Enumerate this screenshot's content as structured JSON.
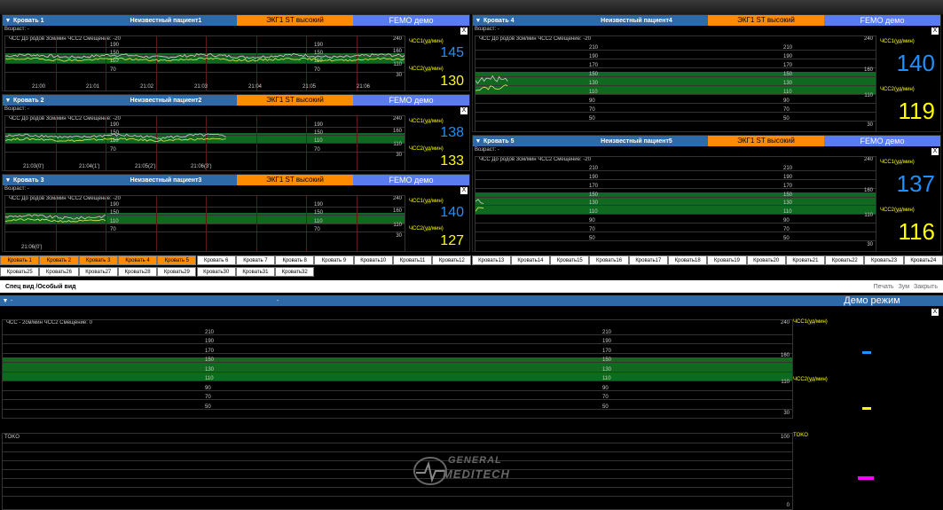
{
  "panels": [
    {
      "bed": "Кровать 1",
      "patient": "Неизвестный пациент1",
      "alarm": "ЭКГ1 ST высокий",
      "mode": "FEMO демо",
      "age": "Возраст: -",
      "close": "X",
      "sub_hdr": "ЧСС     До родов  3см/мин  ЧСС2  Смещение: -20",
      "scale_top": "240",
      "scale_mid": "160",
      "scale_low": "110",
      "scale_bot": "30",
      "grid_left": [
        "190",
        "150",
        "110",
        "70"
      ],
      "grid_right": [
        "190",
        "150",
        "110",
        "70"
      ],
      "times": [
        "21:00",
        "21:01",
        "21:02",
        "21:03",
        "21:04",
        "21:05",
        "21:06"
      ],
      "hr1_label": "ЧСС1(уд/мин)",
      "hr1": "145",
      "hr2_label": "ЧСС2(уд/мин)",
      "hr2": "130"
    },
    {
      "bed": "Кровать 2",
      "patient": "Неизвестный пациент2",
      "alarm": "ЭКГ1 ST высокий",
      "mode": "FEMO демо",
      "age": "Возраст: -",
      "close": "X",
      "sub_hdr": "ЧСС     До родов  3см/мин  ЧСС2  Смещение: -20",
      "scale_top": "240",
      "scale_mid": "160",
      "scale_low": "110",
      "scale_bot": "30",
      "grid_left": [
        "190",
        "150",
        "110",
        "70"
      ],
      "grid_right": [
        "190",
        "150",
        "110",
        "70"
      ],
      "times": [
        "21:03(0')",
        "21:04(1')",
        "21:05(2')",
        "21:06(3')"
      ],
      "hr1_label": "ЧСС1(уд/мин)",
      "hr1": "138",
      "hr2_label": "ЧСС2(уд/мин)",
      "hr2": "133"
    },
    {
      "bed": "Кровать 3",
      "patient": "Неизвестный пациент3",
      "alarm": "ЭКГ1 ST высокий",
      "mode": "FEMO демо",
      "age": "Возраст: -",
      "close": "X",
      "sub_hdr": "ЧСС     До родов  3см/мин  ЧСС2  Смещение: -20",
      "scale_top": "240",
      "scale_mid": "160",
      "scale_low": "110",
      "scale_bot": "30",
      "grid_left": [
        "190",
        "150",
        "110",
        "70"
      ],
      "grid_right": [
        "190",
        "150",
        "110",
        "70"
      ],
      "times": [
        "21:06(0')"
      ],
      "hr1_label": "ЧСС1(уд/мин)",
      "hr1": "140",
      "hr2_label": "ЧСС2(уд/мин)",
      "hr2": "127"
    },
    {
      "bed": "Кровать 4",
      "patient": "Неизвестный пациент4",
      "alarm": "ЭКГ1 ST высокий",
      "mode": "FEMO демо",
      "age": "Возраст: -",
      "close": "X",
      "sub_hdr": "ЧСС     До родов  3см/мин  ЧСС2  Смещение: -20",
      "scale_top": "240",
      "scale_mid": "160",
      "scale_low": "110",
      "scale_bot": "30",
      "grid_left": [
        "210",
        "190",
        "170",
        "150",
        "130",
        "110",
        "90",
        "70",
        "50"
      ],
      "grid_right": [
        "210",
        "190",
        "170",
        "150",
        "130",
        "110",
        "90",
        "70",
        "50"
      ],
      "times": [],
      "hr1_label": "ЧСС1(уд/мин)",
      "hr1": "140",
      "hr2_label": "ЧСС2(уд/мин)",
      "hr2": "119"
    },
    {
      "bed": "Кровать 5",
      "patient": "Неизвестный пациент5",
      "alarm": "ЭКГ1 ST высокий",
      "mode": "FEMO демо",
      "age": "Возраст: -",
      "close": "X",
      "sub_hdr": "ЧСС     До родов  3см/мин  ЧСС2  Смещение: -20",
      "scale_top": "240",
      "scale_mid": "160",
      "scale_low": "110",
      "scale_bot": "30",
      "grid_left": [
        "210",
        "190",
        "170",
        "150",
        "130",
        "110",
        "90",
        "70",
        "50"
      ],
      "grid_right": [
        "210",
        "190",
        "170",
        "150",
        "130",
        "110",
        "90",
        "70",
        "50"
      ],
      "times": [],
      "hr1_label": "ЧСС1(уд/мин)",
      "hr1": "137",
      "hr2_label": "ЧСС2(уд/мин)",
      "hr2": "116"
    }
  ],
  "bed_tabs_row1": [
    "Кровать 1",
    "Кровать 2",
    "Кровать 3",
    "Кровать 4",
    "Кровать 5",
    "Кровать 6",
    "Кровать 7",
    "Кровать 8",
    "Кровать 9",
    "Кровать10",
    "Кровать11",
    "Кровать12",
    "Кровать13",
    "Кровать14",
    "Кровать15",
    "Кровать16",
    "Кровать17",
    "Кровать18",
    "Кровать19",
    "Кровать20",
    "Кровать21",
    "Кровать22",
    "Кровать23",
    "Кровать24"
  ],
  "bed_tabs_row2": [
    "Кровать25",
    "Кровать26",
    "Кровать27",
    "Кровать28",
    "Кровать29",
    "Кровать30",
    "Кровать31",
    "Кровать32"
  ],
  "active_tabs": 5,
  "spec": {
    "title": "Спец вид /Особый вид",
    "print": "Печать",
    "zoom": "Зум",
    "close": "Закрыть"
  },
  "big": {
    "arrow": "▼",
    "dash1": "-",
    "dash2": "-",
    "mode": "Демо режим",
    "close": "X",
    "sub_hdr": "ЧСС       -  2см/мин  ЧСС2  Смещение: 0",
    "grid_left": [
      "210",
      "190",
      "170",
      "150",
      "130",
      "110",
      "90",
      "70",
      "50"
    ],
    "grid_right": [
      "210",
      "190",
      "170",
      "150",
      "130",
      "110",
      "90",
      "70",
      "50"
    ],
    "scale_top": "240",
    "scale_mid": "160",
    "scale_low": "110",
    "scale_bot": "30",
    "hr1_label": "ЧСС1(уд/мин)",
    "hr2_label": "ЧСС2(уд/мин)",
    "toco_label": "TOKO",
    "toco_left": "TOKO",
    "toco_top": "100",
    "toco_bot": "0",
    "logo_line1": "GENERAL",
    "logo_line2": "MEDITECH"
  },
  "colors": {
    "header_blue": "#2f6aa8",
    "alarm_orange": "#ff8c00",
    "mode_blue": "#5b7cf0",
    "band_green": "#0f6a1f",
    "hr1_blue": "#1e90ff",
    "hr2_yellow": "#ffff00",
    "toco_magenta": "#ff00ff"
  }
}
